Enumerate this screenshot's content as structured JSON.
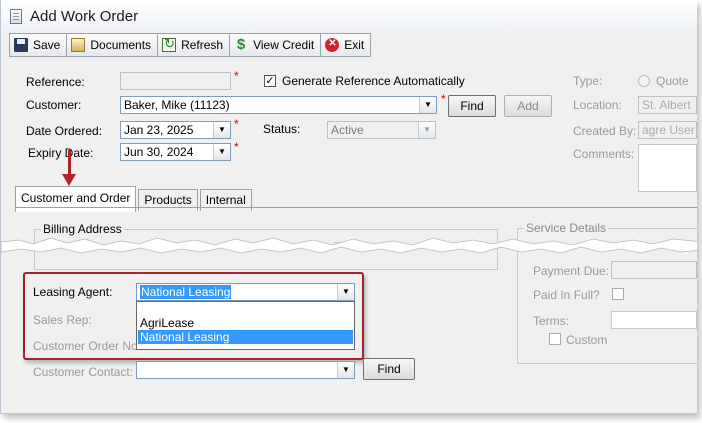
{
  "window": {
    "title": "Add Work Order"
  },
  "toolbar": {
    "save": "Save",
    "documents": "Documents",
    "refresh": "Refresh",
    "view_credit": "View Credit",
    "exit": "Exit"
  },
  "form": {
    "reference_label": "Reference:",
    "reference_value": "",
    "required_mark": "*",
    "generate_ref_label": "Generate Reference Automatically",
    "customer_label": "Customer:",
    "customer_value": "Baker, Mike (11123)",
    "find_label": "Find",
    "add_label": "Add",
    "date_ordered_label": "Date Ordered:",
    "date_ordered_value": "Jan  23, 2025",
    "status_label": "Status:",
    "status_value": "Active",
    "expiry_label": "Expiry Date:",
    "expiry_value": "Jun 30, 2024"
  },
  "right_panel": {
    "type_label": "Type:",
    "quote_label": "Quote",
    "location_label": "Location:",
    "location_value": "St. Albert",
    "created_by_label": "Created By:",
    "created_by_value": "agre User",
    "comments_label": "Comments:"
  },
  "tabs": [
    {
      "label": "Customer and Order"
    },
    {
      "label": "Products"
    },
    {
      "label": "Internal"
    }
  ],
  "billing": {
    "title": "Billing Address",
    "torn_text": "..."
  },
  "service": {
    "title": "Service Details",
    "payment_due_label": "Payment Due:",
    "paid_in_full_label": "Paid In Full?",
    "terms_label": "Terms:",
    "custom_label": "Custom"
  },
  "leasing": {
    "agent_label": "Leasing Agent:",
    "agent_value": "National Leasing",
    "sales_rep_label": "Sales Rep:",
    "customer_order_label": "Customer Order No:",
    "options": [
      "AgriLease",
      "National Leasing"
    ],
    "selected_index": 1
  },
  "contact": {
    "label": "Customer Contact:",
    "value": "",
    "find_label": "Find"
  },
  "colors": {
    "highlight": "#a0242a",
    "selection": "#3399ff"
  }
}
